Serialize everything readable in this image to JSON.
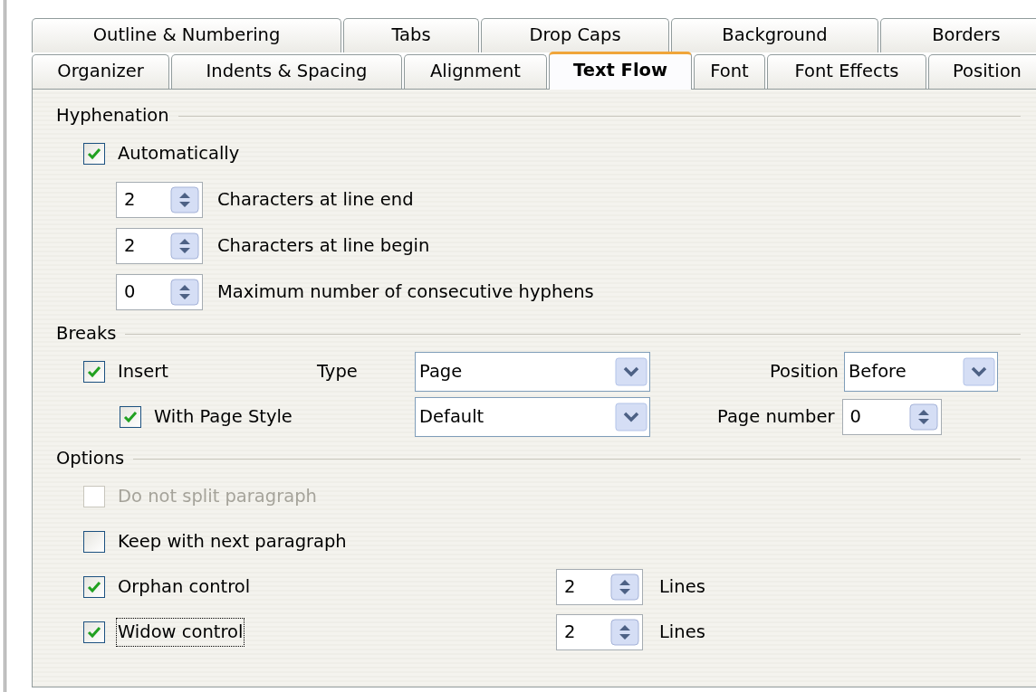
{
  "tabs_row1": [
    {
      "label": "Outline & Numbering",
      "selected": false
    },
    {
      "label": "Tabs",
      "selected": false
    },
    {
      "label": "Drop Caps",
      "selected": false
    },
    {
      "label": "Background",
      "selected": false
    },
    {
      "label": "Borders",
      "selected": false
    }
  ],
  "tabs_row2": [
    {
      "label": "Organizer",
      "selected": false
    },
    {
      "label": "Indents & Spacing",
      "selected": false
    },
    {
      "label": "Alignment",
      "selected": false
    },
    {
      "label": "Text Flow",
      "selected": true
    },
    {
      "label": "Font",
      "selected": false
    },
    {
      "label": "Font Effects",
      "selected": false
    },
    {
      "label": "Position",
      "selected": false
    }
  ],
  "hyphenation": {
    "title": "Hyphenation",
    "automatically": {
      "label": "Automatically",
      "checked": true
    },
    "fields": [
      {
        "value": "2",
        "label": "Characters at line end"
      },
      {
        "value": "2",
        "label": "Characters at line begin"
      },
      {
        "value": "0",
        "label": "Maximum number of consecutive hyphens"
      }
    ]
  },
  "breaks": {
    "title": "Breaks",
    "insert": {
      "label": "Insert",
      "checked": true
    },
    "type": {
      "label": "Type",
      "value": "Page"
    },
    "position": {
      "label": "Position",
      "value": "Before"
    },
    "with_page_style": {
      "label": "With Page Style",
      "checked": true
    },
    "page_style": {
      "value": "Default"
    },
    "page_number": {
      "label": "Page number",
      "value": "0"
    }
  },
  "options": {
    "title": "Options",
    "items": [
      {
        "label": "Do not split paragraph",
        "checked": false,
        "disabled": true,
        "focused": false
      },
      {
        "label": "Keep with next paragraph",
        "checked": false,
        "disabled": false,
        "focused": false
      },
      {
        "label": "Orphan control",
        "checked": true,
        "disabled": false,
        "focused": false,
        "spin": {
          "value": "2",
          "unit": "Lines"
        }
      },
      {
        "label": "Widow control",
        "checked": true,
        "disabled": false,
        "focused": true,
        "spin": {
          "value": "2",
          "unit": "Lines"
        }
      }
    ]
  }
}
